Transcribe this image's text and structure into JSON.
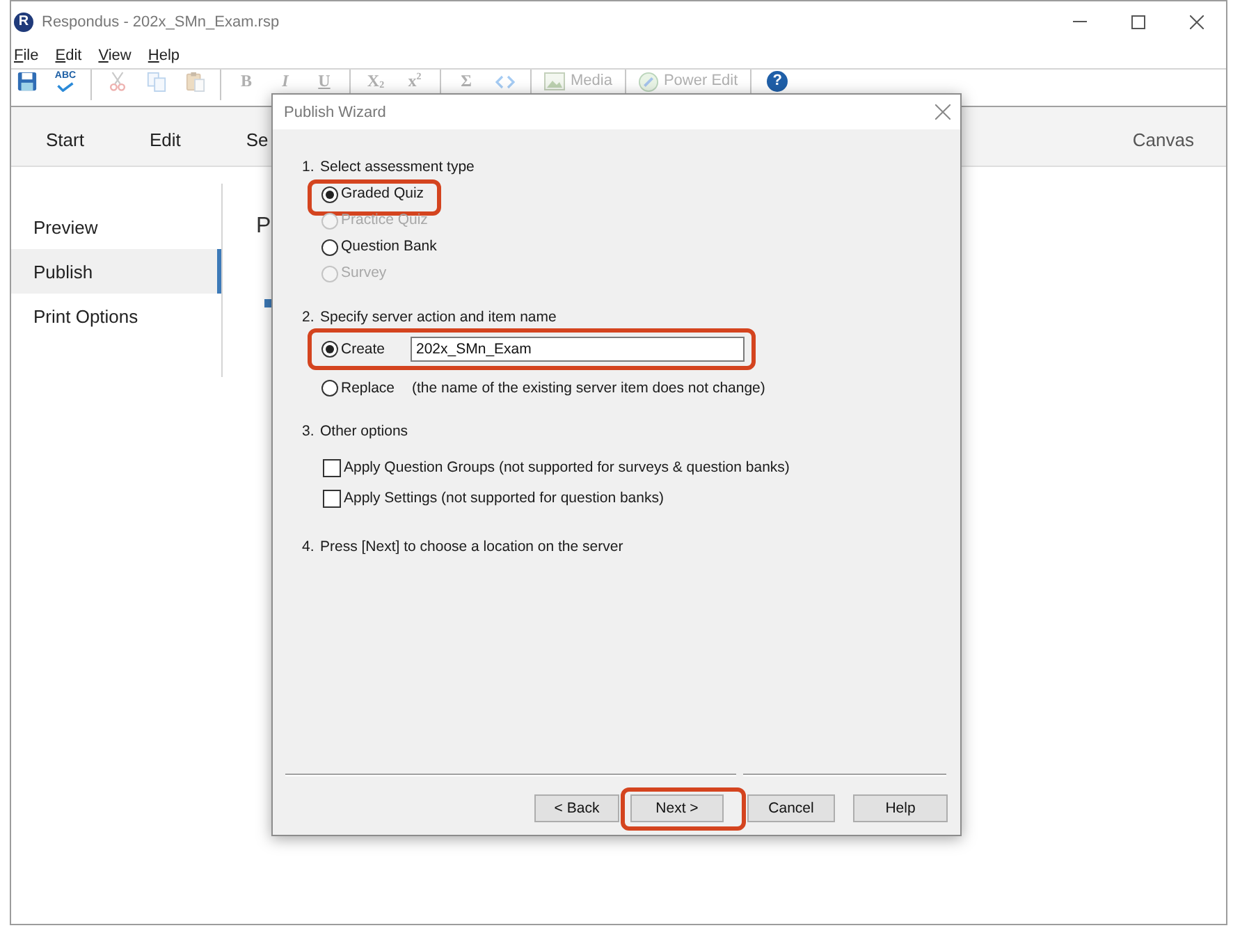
{
  "window": {
    "logo": "R",
    "title": "Respondus - 202x_SMn_Exam.rsp"
  },
  "menu": [
    "File",
    "Edit",
    "View",
    "Help"
  ],
  "toolbar": [
    {
      "kind": "save",
      "disabled": false
    },
    {
      "kind": "spellcheck",
      "label": "ABC",
      "disabled": false
    },
    {
      "kind": "separator"
    },
    {
      "kind": "cut",
      "disabled": true
    },
    {
      "kind": "copy",
      "disabled": true
    },
    {
      "kind": "paste",
      "disabled": true
    },
    {
      "kind": "separator"
    },
    {
      "kind": "bold",
      "label": "B",
      "disabled": true
    },
    {
      "kind": "italic",
      "label": "I",
      "disabled": true
    },
    {
      "kind": "underline",
      "label": "U",
      "disabled": true
    },
    {
      "kind": "separator"
    },
    {
      "kind": "subscript",
      "label": "X$_{2}$",
      "disabled": true
    },
    {
      "kind": "superscript",
      "label": "x$^{2}$",
      "disabled": true
    },
    {
      "kind": "separator"
    },
    {
      "kind": "sum",
      "label": "Σ",
      "disabled": true
    },
    {
      "kind": "code",
      "disabled": true
    },
    {
      "kind": "separator"
    },
    {
      "kind": "media",
      "label": "Media",
      "disabled": true
    },
    {
      "kind": "separator"
    },
    {
      "kind": "power_edit",
      "label": "Power Edit",
      "disabled": true
    },
    {
      "kind": "separator"
    },
    {
      "kind": "help",
      "label": "?",
      "disabled": false
    }
  ],
  "tabs": [
    {
      "label": "Start",
      "selected": false
    },
    {
      "label": "Edit",
      "selected": false
    },
    {
      "label": "Se",
      "selected": false
    }
  ],
  "lms": "Canvas",
  "sidebar": {
    "items": [
      {
        "label": "Preview",
        "selected": false
      },
      {
        "label": "Publish",
        "selected": true
      },
      {
        "label": "Print Options",
        "selected": false
      }
    ]
  },
  "content": {
    "heading": "P"
  },
  "dialog": {
    "title": "Publish Wizard",
    "sections": [
      {
        "number": "1.",
        "title": "Select assessment type",
        "options": [
          {
            "kind": "radio",
            "label": "Graded Quiz",
            "selected": true,
            "disabled": false,
            "highlighted": true
          },
          {
            "kind": "radio",
            "label": "Practice Quiz",
            "selected": false,
            "disabled": true,
            "highlighted": false
          },
          {
            "kind": "radio",
            "label": "Question Bank",
            "selected": false,
            "disabled": false,
            "highlighted": false
          },
          {
            "kind": "radio",
            "label": "Survey",
            "selected": false,
            "disabled": true,
            "highlighted": false
          }
        ]
      },
      {
        "number": "2.",
        "title": "Specify server action and item name",
        "options": [
          {
            "kind": "radio",
            "label": "Create",
            "selected": true,
            "disabled": false,
            "highlighted": true,
            "value": "202x_SMn_Exam"
          },
          {
            "kind": "radio",
            "label": "Replace",
            "selected": false,
            "disabled": false,
            "highlighted": false,
            "note": "(the name of the existing server item does not change)"
          }
        ]
      },
      {
        "number": "3.",
        "title": "Other options",
        "options": [
          {
            "kind": "checkbox",
            "label": "Apply Question Groups (not supported for surveys & question banks)",
            "checked": false,
            "highlighted": false
          },
          {
            "kind": "checkbox",
            "label": "Apply Settings (not supported for question banks)",
            "checked": false,
            "highlighted": false
          }
        ]
      },
      {
        "number": "4.",
        "title": "Press [Next] to choose a location on the server"
      }
    ],
    "buttons": [
      {
        "label": "< Back",
        "highlighted": false
      },
      {
        "label": "Next >",
        "highlighted": true
      },
      {
        "label": "Cancel",
        "highlighted": false
      },
      {
        "label": "Help",
        "highlighted": false
      }
    ]
  }
}
